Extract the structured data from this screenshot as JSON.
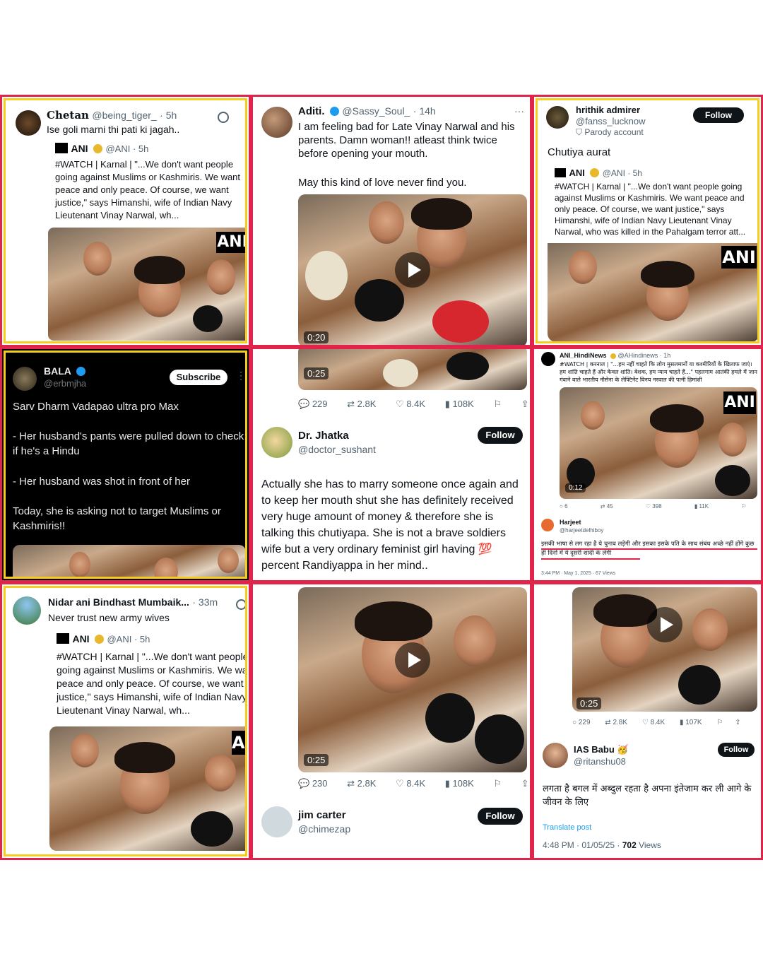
{
  "cell1": {
    "name": "Chetan",
    "handle": "@being_tiger_",
    "time": "· 5h",
    "text": "Ise goli marni thi pati ki jagah..",
    "quote": {
      "name": "ANI",
      "handle": "@ANI · 5h",
      "text": "#WATCH | Karnal | \"...We don't want people going against Muslims or Kashmiris. We want peace and only peace. Of course, we want justice,\" says Himanshi, wife of Indian Navy Lieutenant Vinay Narwal, wh..."
    },
    "badge": "ANI"
  },
  "cell2": {
    "name": "Aditi.",
    "handle": "@Sassy_Soul_",
    "time": "· 14h",
    "text1": "I am feeling bad for Late Vinay Narwal and his parents. Damn woman!! atleast think twice before opening your mouth.",
    "text2": "May this kind of love never find you.",
    "duration": "0:20"
  },
  "cell3": {
    "name": "hrithik admirer",
    "handle": "@fanss_lucknow",
    "parody": "Parody account",
    "follow": "Follow",
    "text": "Chutiya aurat",
    "quote": {
      "name": "ANI",
      "handle": "@ANI · 5h",
      "text": "#WATCH | Karnal | \"...We don't want people going against Muslims or Kashmiris. We want peace and only peace. Of course, we want justice,\" says Himanshi, wife of Indian Navy Lieutenant Vinay Narwal, who was killed in the Pahalgam terror att..."
    },
    "badge": "ANI"
  },
  "cell4": {
    "name": "BALA",
    "handle": "@erbmjha",
    "subscribe": "Subscribe",
    "line1": "Sarv Dharm Vadapao ultra pro Max",
    "line2": "- Her husband's pants were pulled down to check if he's a Hindu",
    "line3": "- Her husband was shot in front of her",
    "line4": "Today, she is asking not to target Muslims or Kashmiris!!"
  },
  "cell5": {
    "duration": "0:25",
    "metrics": {
      "replies": "229",
      "reposts": "2.8K",
      "likes": "8.4K",
      "views": "108K"
    },
    "name": "Dr. Jhatka",
    "handle": "@doctor_sushant",
    "follow": "Follow",
    "text": "Actually she has to marry someone once again and to keep her mouth shut she has definitely received very huge amount of money & therefore she is talking this chutiyapa. She is not a brave soldiers wife but a very ordinary feminist girl having 💯 percent Randiyappa in her mind.."
  },
  "cell6": {
    "name": "ANI_HindiNews",
    "handle": "@AHindinews · 1h",
    "text": "#WATCH | करनाल | \"...हम नहीं चाहते कि लोग मुसलमानों या कश्मीरियों के खिलाफ जाएं। हम शांति चाहते हैं और केवल शांति। बेशक, हम न्याय चाहते हैं...\" पहलगाम आतंकी हमले में जान गंवाने वाले भारतीय नौसेना के लेफ्टिनेंट विनय नरवाल की पत्नी हिमांशी",
    "badge": "ANI",
    "duration": "0:12",
    "metrics": {
      "replies": "6",
      "reposts": "45",
      "likes": "398",
      "views": "11K"
    },
    "reply_name": "Harjeet",
    "reply_handle": "@harjeetdelhiboy",
    "reply_text": "इसकी भाषा से लग रहा है ये चुनाव लड़ेगी और इसका इसके पति के साथ संबंध अच्छे नहीं होंगे कुछ ही दिनों में ये दूसरी शादी के लेगी",
    "reply_meta": "3:44 PM · May 1, 2025 · 67 Views"
  },
  "cell7": {
    "name": "Nidar ani Bindhast Mumbaik...",
    "time": "· 33m",
    "text": "Never trust new army wives",
    "quote": {
      "name": "ANI",
      "handle": "@ANI · 5h",
      "text": "#WATCH | Karnal | \"...We don't want people going against Muslims or Kashmiris. We want peace and only peace. Of course, we want justice,\" says Himanshi, wife of Indian Navy Lieutenant Vinay Narwal, wh..."
    },
    "badge": "ANI"
  },
  "cell8": {
    "duration": "0:25",
    "metrics": {
      "replies": "230",
      "reposts": "2.8K",
      "likes": "8.4K",
      "views": "108K"
    },
    "name": "jim carter",
    "handle": "@chimezap",
    "follow": "Follow"
  },
  "cell9": {
    "duration": "0:25",
    "metrics": {
      "replies": "229",
      "reposts": "2.8K",
      "likes": "8.4K",
      "views": "107K"
    },
    "name": "IAS Babu 🥳",
    "handle": "@ritanshu08",
    "follow": "Follow",
    "text": "लगता है बगल में अब्दुल रहता है अपना इंतेजाम कर ली आगे के जीवन के लिए",
    "translate": "Translate post",
    "meta_time": "4:48 PM · 01/05/25 · ",
    "meta_views": "702",
    "meta_views_label": " Views"
  },
  "colors": {
    "red_border": "#e0244a",
    "yellow_border": "#f5cd1d",
    "verified_blue": "#1d9bf0",
    "verified_gold": "#e8b82c"
  }
}
